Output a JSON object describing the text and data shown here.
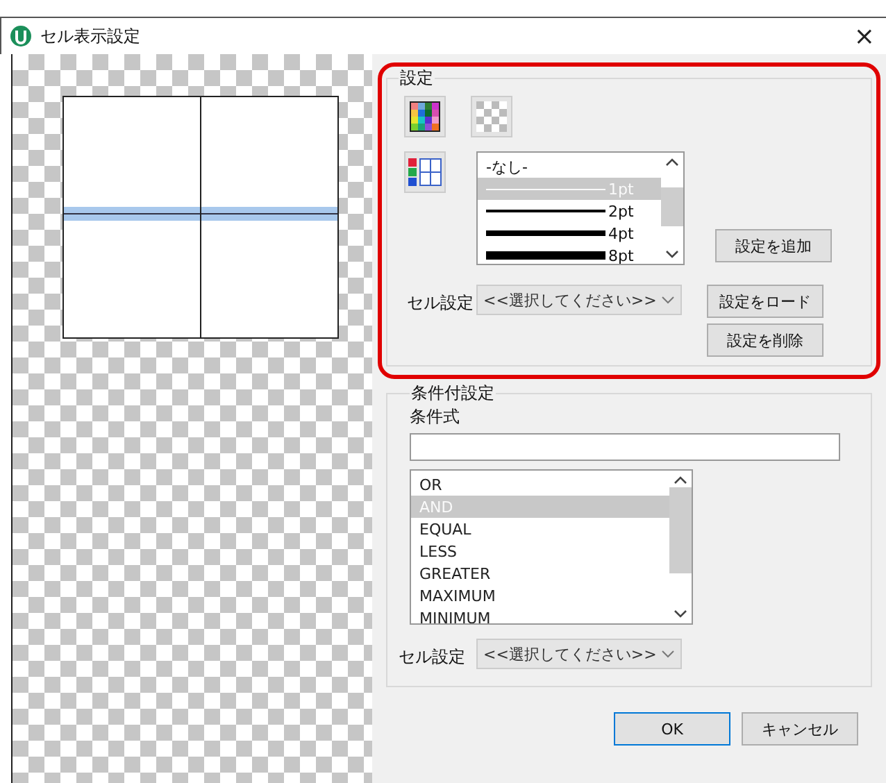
{
  "window": {
    "title": "セル表示設定",
    "close": "×"
  },
  "settings_group": {
    "title": "設定",
    "highlighted": true,
    "line_styles": [
      {
        "label": "-なし-",
        "kind": "none",
        "selected": false
      },
      {
        "label": "1pt",
        "kind": "thin",
        "selected": true
      },
      {
        "label": "2pt",
        "kind": "medium",
        "selected": false
      },
      {
        "label": "4pt",
        "kind": "thick",
        "selected": false
      },
      {
        "label": "8pt",
        "kind": "heavy",
        "selected": false
      }
    ],
    "add_button": "設定を追加",
    "cell_setting_label": "セル設定",
    "cell_setting_value": "<<選択してください>>",
    "load_button": "設定をロード",
    "delete_button": "設定を削除"
  },
  "condition_group": {
    "title": "条件付設定",
    "expression_label": "条件式",
    "operators": [
      {
        "label": "OR",
        "selected": false
      },
      {
        "label": "AND",
        "selected": true
      },
      {
        "label": "EQUAL",
        "selected": false
      },
      {
        "label": "LESS",
        "selected": false
      },
      {
        "label": "GREATER",
        "selected": false
      },
      {
        "label": "MAXIMUM",
        "selected": false
      },
      {
        "label": "MINIMUM",
        "selected": false
      }
    ],
    "cell_setting_label": "セル設定",
    "cell_setting_value": "<<選択してください>>"
  },
  "buttons": [
    {
      "label": "OK",
      "kind": "default"
    },
    {
      "label": "キャンセル",
      "kind": "normal"
    }
  ]
}
